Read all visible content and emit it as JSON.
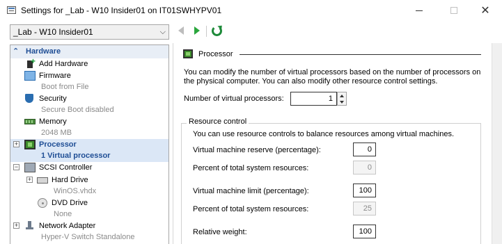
{
  "window": {
    "title": "Settings for _Lab - W10 Insider01 on IT01SWHYPV01"
  },
  "toolbar": {
    "vm_selector_value": "_Lab - W10 Insider01"
  },
  "tree": {
    "header": "Hardware",
    "items": [
      {
        "label": "Add Hardware",
        "sub": ""
      },
      {
        "label": "Firmware",
        "sub": "Boot from File"
      },
      {
        "label": "Security",
        "sub": "Secure Boot disabled"
      },
      {
        "label": "Memory",
        "sub": "2048 MB"
      },
      {
        "label": "Processor",
        "sub": "1 Virtual processor"
      },
      {
        "label": "SCSI Controller",
        "sub": ""
      },
      {
        "label": "Hard Drive",
        "sub": "WinOS.vhdx"
      },
      {
        "label": "DVD Drive",
        "sub": "None"
      },
      {
        "label": "Network Adapter",
        "sub": "Hyper-V Switch Standalone"
      }
    ],
    "expander_plus": "+",
    "expander_minus": "−"
  },
  "processor": {
    "section_title": "Processor",
    "description": "You can modify the number of virtual processors based on the number of processors on the physical computer. You can also modify other resource control settings.",
    "num_vp_label": "Number of virtual processors:",
    "num_vp_value": "1",
    "resource_control": {
      "legend": "Resource control",
      "description": "You can use resource controls to balance resources among virtual machines.",
      "reserve_label": "Virtual machine reserve (percentage):",
      "reserve_value": "0",
      "reserve_total_label": "Percent of total system resources:",
      "reserve_total_value": "0",
      "limit_label": "Virtual machine limit (percentage):",
      "limit_value": "100",
      "limit_total_label": "Percent of total system resources:",
      "limit_total_value": "25",
      "weight_label": "Relative weight:",
      "weight_value": "100"
    }
  },
  "colors": {
    "selection": "#dbe7f6",
    "header_blue": "#1f4e95",
    "accent_green": "#2aa63c"
  }
}
